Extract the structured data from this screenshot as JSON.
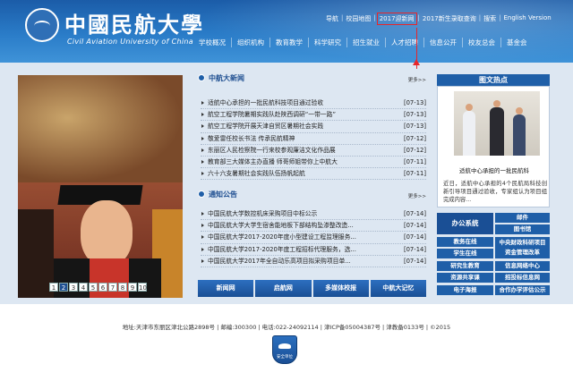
{
  "header": {
    "logo_cn": "中國民航大學",
    "logo_en": "Civil Aviation University of China",
    "top_links": [
      "导航",
      "校园地图",
      "2017迎新网",
      "2017新生录取查询",
      "搜索",
      "English Version"
    ],
    "highlighted_link": "2017迎新网",
    "annotation_color": "#e8262a"
  },
  "nav": {
    "items": [
      "学校概况",
      "组织机构",
      "教育教学",
      "科学研究",
      "招生就业",
      "人才招聘",
      "信息公开",
      "校友总会",
      "基金会"
    ]
  },
  "slider": {
    "pages": [
      "1",
      "2",
      "3",
      "4",
      "5",
      "6",
      "7",
      "8",
      "9",
      "10"
    ],
    "active": "2"
  },
  "news": {
    "title": "中航大新闻",
    "more": "更多>>",
    "items": [
      {
        "title": "适航中心承担的一批民航科技项目通过验收",
        "date": "[07-13]"
      },
      {
        "title": "航空工程学院暑期实践队赴陕西调研“一带一路”",
        "date": "[07-13]"
      },
      {
        "title": "航空工程学院开展天津自贸区暑期社会实践",
        "date": "[07-13]"
      },
      {
        "title": "敬爱雷任校长书法 传承民航精神",
        "date": "[07-12]"
      },
      {
        "title": "东丽区人民检察院一行来校参观廉洁文化作品展",
        "date": "[07-12]"
      },
      {
        "title": "教育部三大媒体主办直播 师哥师姐带你上中航大",
        "date": "[07-11]"
      },
      {
        "title": "六十六支暑期社会实践队伍扬帆起航",
        "date": "[07-11]"
      }
    ]
  },
  "notices": {
    "title": "通知公告",
    "more": "更多>>",
    "items": [
      {
        "title": "中国民航大学数控机床采购项目中标公示",
        "date": "[07-14]"
      },
      {
        "title": "中国民航大学大学生宿舍能地板下部结构坠渗整改造...",
        "date": "[07-14]"
      },
      {
        "title": "中国民航大学2017-2020年度小型建设工程监理服务...",
        "date": "[07-14]"
      },
      {
        "title": "中国民航大学2017-2020年度工程招标代理服务，选...",
        "date": "[07-14]"
      },
      {
        "title": "中国民航大学2017年全自动乐高项目拟采购项目单...",
        "date": "[07-14]"
      }
    ]
  },
  "bottom_buttons": [
    "新闻网",
    "启航网",
    "多媒体校报",
    "中航大记忆"
  ],
  "pictures": {
    "title": "图文热点",
    "caption": "适航中心承担的一批民航科",
    "description": "近日，适航中心承担的4个民航局科技创新引导项目通过验收，专家组认为项目组完成内容..."
  },
  "quick_links": {
    "office": "办公系统",
    "items": [
      "邮件",
      "图书馆",
      "教务在线",
      "中央财政科研项目资金管理改革",
      "学生在线",
      "研究生教育",
      "信息网络中心",
      "资源共享课",
      "招投标信息网",
      "电子海报",
      "合作办学评估公示"
    ]
  },
  "footer": {
    "address": "地址:天津市东丽区津北公路2898号 | 邮编:300300 | 电话:022-24092114 | 津ICP备05004387号 | 津教备0133号 | ©2015",
    "badge_text": "安全单位"
  }
}
